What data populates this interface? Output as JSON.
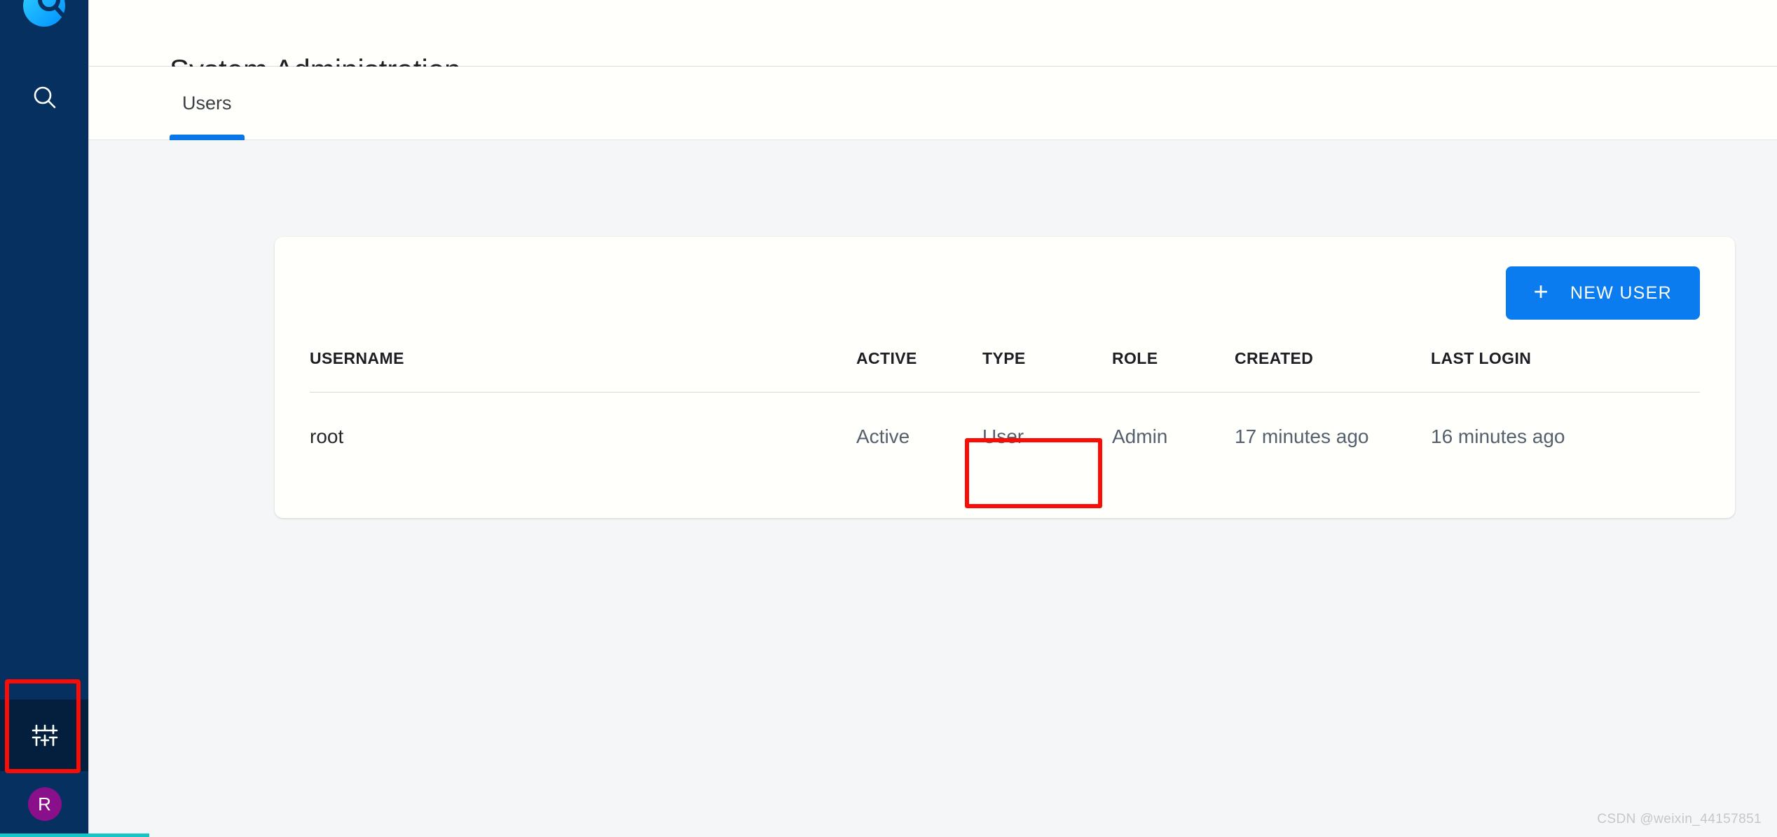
{
  "colors": {
    "sidebar_bg": "#05305f",
    "sidebar_active": "#041f3e",
    "accent_blue": "#0a7cf0",
    "tab_indicator": "#0a77e8",
    "avatar_purple": "#8a0f8a",
    "annotation_red": "#fb0d07",
    "bottom_accent": "#15c5c8",
    "page_bg": "#f5f6f7",
    "card_bg": "#fffffc",
    "text_dark": "#1c1e23",
    "text_muted": "#55606e"
  },
  "sidebar": {
    "logo_name": "graylog-logo-icon",
    "nav_items": [
      {
        "name": "search-icon",
        "label": "Search"
      }
    ],
    "bottom_items": [
      {
        "name": "sliders-settings-icon",
        "label": "System / Configuration",
        "active": true
      }
    ],
    "avatar": {
      "initial": "R",
      "name": "user-avatar"
    }
  },
  "header": {
    "title": "System Administration"
  },
  "tabs": [
    {
      "label": "Users",
      "active": true,
      "name": "tab-users"
    }
  ],
  "toolbar": {
    "new_user_label": "NEW USER",
    "new_user_icon": "plus-icon"
  },
  "table": {
    "columns": [
      "USERNAME",
      "ACTIVE",
      "TYPE",
      "ROLE",
      "CREATED",
      "LAST LOGIN"
    ],
    "rows": [
      {
        "username": "root",
        "active": "Active",
        "type": "User",
        "role": "Admin",
        "created": "17 minutes ago",
        "last_login": "16 minutes ago"
      }
    ]
  },
  "annotations": [
    {
      "name": "annotation-role-cell",
      "target": "Admin"
    },
    {
      "name": "annotation-settings-nav",
      "target": "System / Configuration"
    }
  ],
  "watermark": {
    "text": "CSDN @weixin_44157851"
  }
}
